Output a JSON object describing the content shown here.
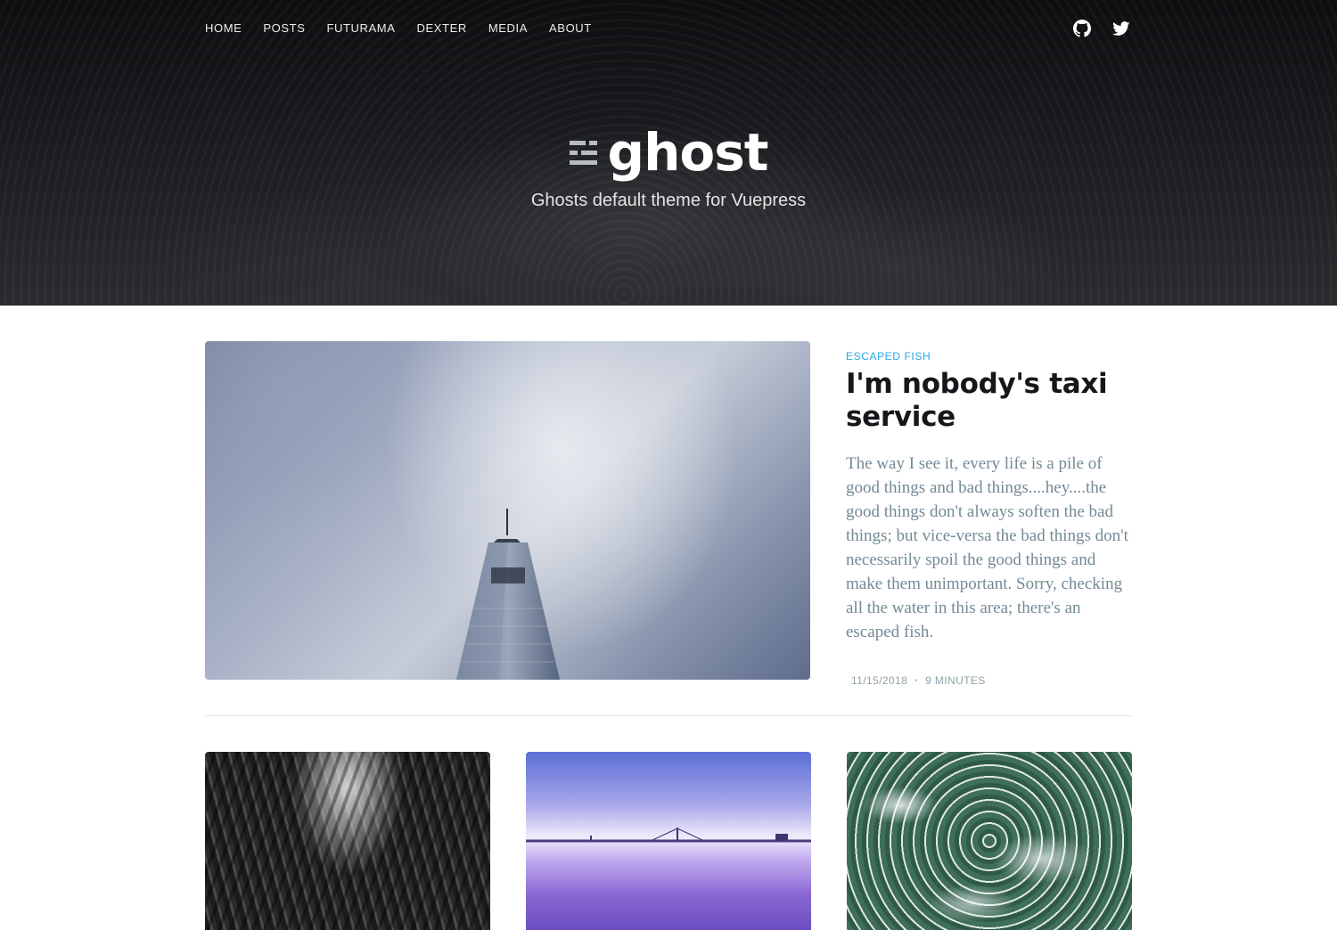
{
  "header": {
    "nav": [
      {
        "label": "HOME"
      },
      {
        "label": "POSTS"
      },
      {
        "label": "FUTURAMA"
      },
      {
        "label": "DEXTER"
      },
      {
        "label": "MEDIA"
      },
      {
        "label": "ABOUT"
      }
    ],
    "social": [
      {
        "icon": "github-icon"
      },
      {
        "icon": "twitter-icon"
      }
    ],
    "logo_text": "ghost",
    "tagline": "Ghosts default theme for Vuepress"
  },
  "featured_post": {
    "tag": "ESCAPED FISH",
    "title": "I'm nobody's taxi service",
    "excerpt": "The way I see it, every life is a pile of good things and bad things....hey....the good things don't always soften the bad things; but vice-versa the bad things don't necessarily spoil the good things and make them unimportant. Sorry, checking all the water in this area; there's an escaped fish.",
    "date": "11/15/2018",
    "separator": "•",
    "reading_time": "9 MINUTES"
  },
  "colors": {
    "accent": "#26a8ed",
    "excerpt": "#738a94",
    "meta": "#90a2aa"
  }
}
